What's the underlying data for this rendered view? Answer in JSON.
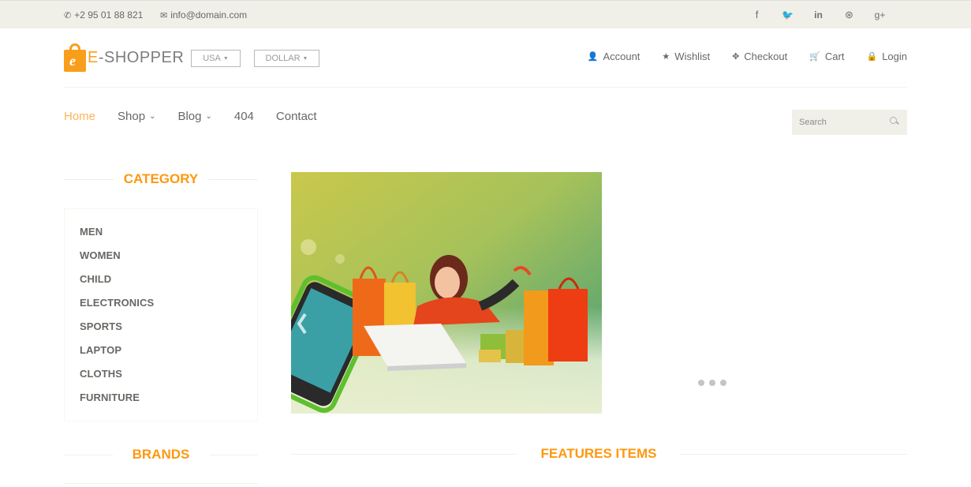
{
  "topbar": {
    "phone": "+2 95 01 88 821",
    "email": "info@domain.com",
    "social_icons": [
      "facebook-icon",
      "twitter-icon",
      "linkedin-icon",
      "dribbble-icon",
      "google-plus-icon"
    ],
    "social_glyphs": [
      "f",
      "🐦",
      "in",
      "⊛",
      "g+"
    ]
  },
  "header": {
    "logo_first": "E",
    "logo_rest": "-SHOPPER",
    "country": "USA",
    "currency": "DOLLAR",
    "account_links": [
      {
        "label": "Account",
        "icon": "user-icon"
      },
      {
        "label": "Wishlist",
        "icon": "star-icon"
      },
      {
        "label": "Checkout",
        "icon": "crosshair-icon"
      },
      {
        "label": "Cart",
        "icon": "cart-icon"
      },
      {
        "label": "Login",
        "icon": "lock-icon"
      }
    ]
  },
  "mainnav": {
    "items": [
      {
        "label": "Home",
        "active": true
      },
      {
        "label": "Shop",
        "dropdown": true
      },
      {
        "label": "Blog",
        "dropdown": true
      },
      {
        "label": "404"
      },
      {
        "label": "Contact"
      }
    ],
    "search_placeholder": "Search"
  },
  "sidebar": {
    "category_title": "CATEGORY",
    "categories": [
      "MEN",
      "WOMEN",
      "CHILD",
      "ELECTRONICS",
      "SPORTS",
      "LAPTOP",
      "CLOTHS",
      "FURNITURE"
    ],
    "brands_title": "BRANDS"
  },
  "main": {
    "features_title": "FEATURES ITEMS"
  },
  "colors": {
    "accent": "#FE980F",
    "topbar_bg": "#F0F0E9",
    "text": "#696763"
  }
}
